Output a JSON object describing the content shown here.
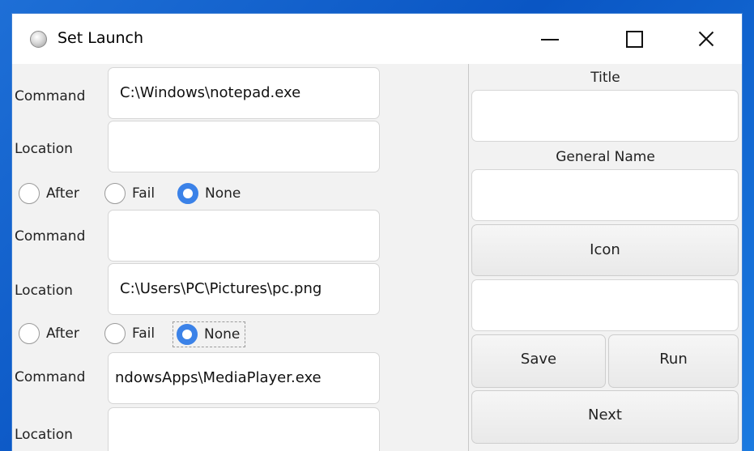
{
  "window": {
    "title": "Set Launch",
    "icon": "disc-app-icon",
    "controls": {
      "minimize": "minimize-icon",
      "maximize": "maximize-icon",
      "close": "close-icon"
    }
  },
  "left": {
    "groups": [
      {
        "command_label": "Command",
        "command_value": "C:\\Windows\\notepad.exe",
        "location_label": "Location",
        "location_value": "",
        "options": [
          "After",
          "Fail",
          "None"
        ],
        "selected": "None"
      },
      {
        "command_label": "Command",
        "command_value": "",
        "location_label": "Location",
        "location_value": "C:\\Users\\PC\\Pictures\\pc.png",
        "options": [
          "After",
          "Fail",
          "None"
        ],
        "selected": "None"
      },
      {
        "command_label": "Command",
        "command_value": "ndowsApps\\MediaPlayer.exe",
        "location_label": "Location",
        "location_value": ""
      }
    ]
  },
  "right": {
    "title_label": "Title",
    "title_value": "",
    "general_name_label": "General Name",
    "general_name_value": "",
    "icon_button": "Icon",
    "icon_value": "",
    "save_button": "Save",
    "run_button": "Run",
    "next_button": "Next"
  },
  "colors": {
    "desktop": "#0a56c4",
    "radio_selected": "#3b82e8",
    "window_bg": "#f2f2f2"
  }
}
